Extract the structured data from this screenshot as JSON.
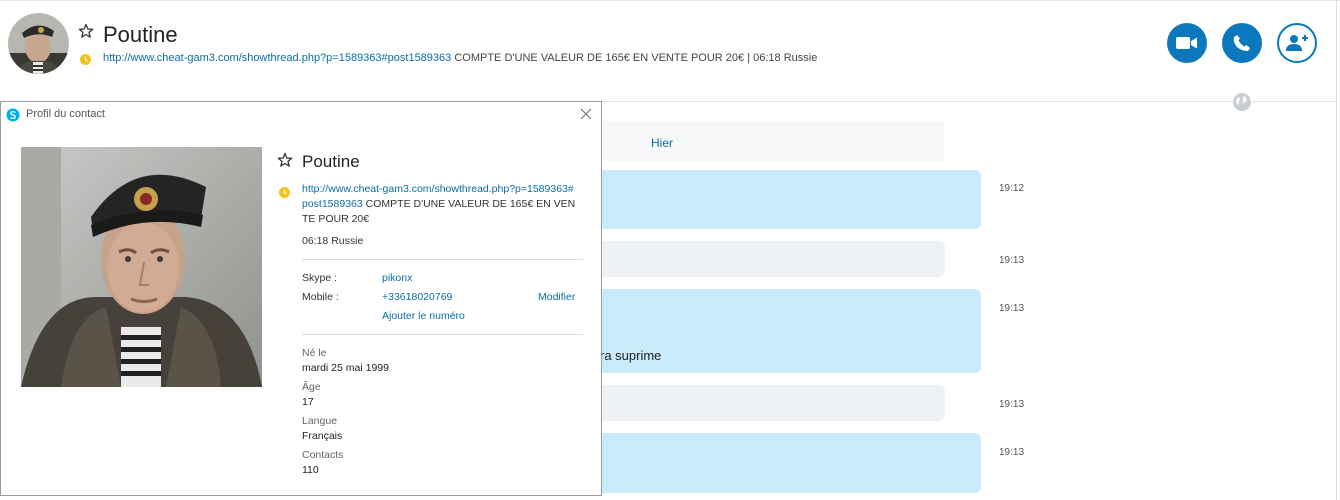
{
  "header": {
    "contact_name": "Poutine",
    "mood_link": "http://www.cheat-gam3.com/showthread.php?p=1589363#post1589363",
    "mood_text": " COMPTE D'UNE VALEUR DE 165€ EN VENTE POUR 20€",
    "separator": " | ",
    "local_time": "06:18 Russie",
    "buttons": {
      "video": "video-call",
      "call": "audio-call",
      "add": "add-people"
    },
    "accent": "#0b77bd",
    "status_color": "#f5c21b"
  },
  "conversation": {
    "day_label": "Hier",
    "messages": [
      {
        "direction": "out",
        "time": "19:12",
        "text": ""
      },
      {
        "direction": "in",
        "time": "19:13",
        "text": ""
      },
      {
        "direction": "out",
        "time": "19:13",
        "text": "ra suprime"
      },
      {
        "direction": "in",
        "time": "19:13",
        "text": ""
      },
      {
        "direction": "out",
        "time": "19:13",
        "text": ""
      }
    ]
  },
  "profile": {
    "window_title": "Profil du contact",
    "name": "Poutine",
    "mood_link": "http://www.cheat-gam3.com/showthread.php?p=1589363#post1589363",
    "mood_text": " COMPTE D'UNE VALEUR DE 165€ EN VENTE POUR 20€",
    "local_time": "06:18 Russie",
    "skype_label": "Skype :",
    "skype_value": "pikonx",
    "mobile_label": "Mobile :",
    "mobile_value": "+33618020769",
    "modify_label": "Modifier",
    "add_number_label": "Ajouter le numéro",
    "born_label": "Né le",
    "born_value": "mardi 25 mai 1999",
    "age_label": "Âge",
    "age_value": "17",
    "language_label": "Langue",
    "language_value": "Français",
    "contacts_label": "Contacts",
    "contacts_value": "110"
  }
}
